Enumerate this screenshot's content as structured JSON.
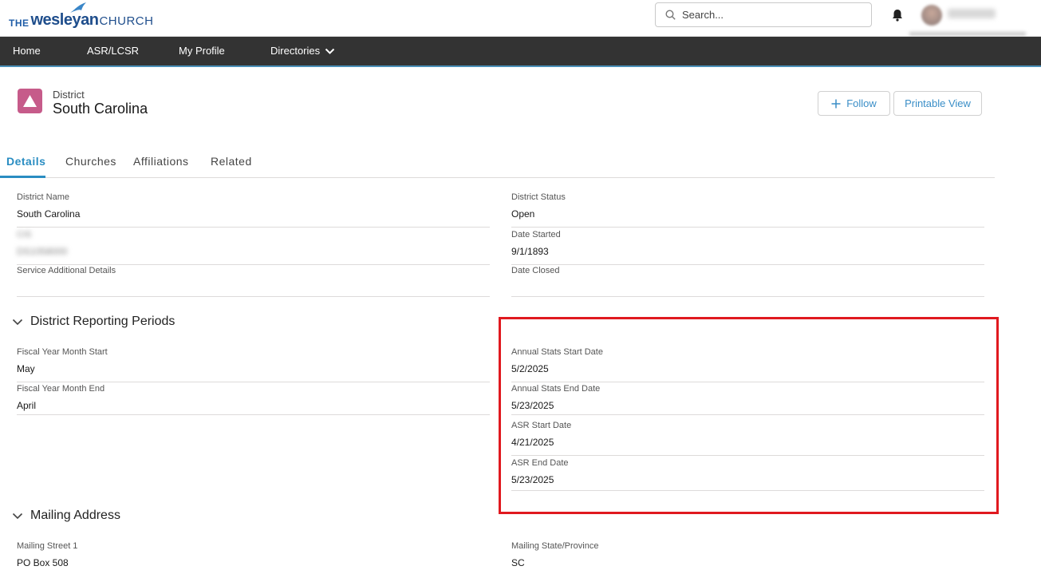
{
  "header": {
    "logo_the": "THE",
    "logo_wesleyan": "wesleyan",
    "logo_church": "CHURCH",
    "search_placeholder": "Search...",
    "user_name": "User Name"
  },
  "nav": {
    "items": [
      {
        "label": "Home"
      },
      {
        "label": "ASR/LCSR"
      },
      {
        "label": "My Profile"
      },
      {
        "label": "Directories"
      }
    ]
  },
  "record": {
    "type": "District",
    "name": "South Carolina",
    "follow_label": "Follow",
    "printable_label": "Printable View",
    "icon_color": "#c65b8a"
  },
  "tabs": [
    {
      "label": "Details",
      "active": true
    },
    {
      "label": "Churches"
    },
    {
      "label": "Affiliations"
    },
    {
      "label": "Related"
    }
  ],
  "details": {
    "district_name_label": "District Name",
    "district_name": "South Carolina",
    "district_status_label": "District Status",
    "district_status": "Open",
    "hidden_label": "CIS",
    "hidden_value": "DS1058000",
    "date_started_label": "Date Started",
    "date_started": "9/1/1893",
    "service_details_label": "Service Additional Details",
    "service_details": "",
    "date_closed_label": "Date Closed",
    "date_closed": ""
  },
  "reporting": {
    "section_title": "District Reporting Periods",
    "fy_start_label": "Fiscal Year Month Start",
    "fy_start": "May",
    "fy_end_label": "Fiscal Year Month End",
    "fy_end": "April",
    "annual_start_label": "Annual Stats Start Date",
    "annual_start": "5/2/2025",
    "annual_end_label": "Annual Stats End Date",
    "annual_end": "5/23/2025",
    "asr_start_label": "ASR Start Date",
    "asr_start": "4/21/2025",
    "asr_end_label": "ASR End Date",
    "asr_end": "5/23/2025"
  },
  "mailing": {
    "section_title": "Mailing Address",
    "street1_label": "Mailing Street 1",
    "street1": "PO Box 508",
    "state_label": "Mailing State/Province",
    "state": "SC"
  },
  "colors": {
    "accent": "#2a8dc2",
    "nav_bg": "#333333",
    "highlight": "#e0191f"
  }
}
